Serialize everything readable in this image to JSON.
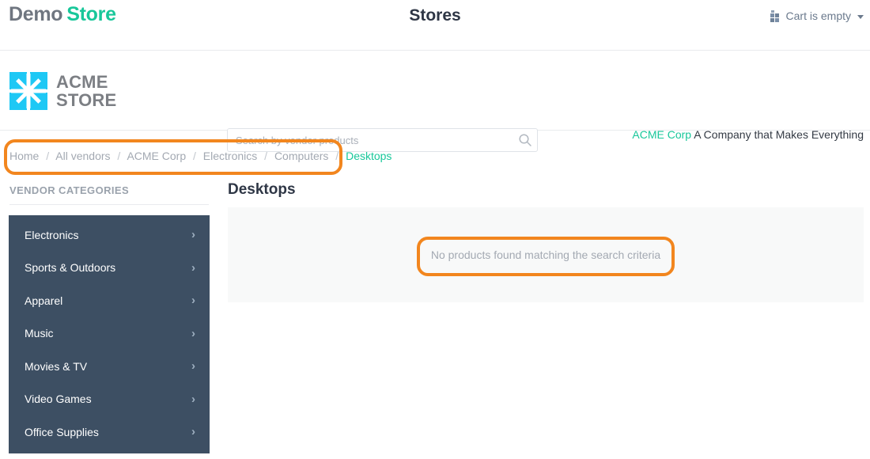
{
  "topbar": {
    "brand_primary": "Demo",
    "brand_secondary": "Store",
    "page_heading": "Stores",
    "cart_label": "Cart is empty",
    "cart_icon": "cart-grid-icon",
    "caret_icon": "chevron-down-icon"
  },
  "vendor_header": {
    "logo_line1": "ACME",
    "logo_line2": "STORE",
    "logo_icon": "acme-star-square-icon",
    "search_placeholder": "Search by vendor products",
    "search_value": "",
    "search_icon": "search-icon",
    "vendor_link": "ACME Corp",
    "vendor_tagline": "A Company that Makes Everything"
  },
  "breadcrumb": {
    "separator": "/",
    "items": [
      {
        "label": "Home",
        "current": false
      },
      {
        "label": "All vendors",
        "current": false
      },
      {
        "label": "ACME Corp",
        "current": false
      },
      {
        "label": "Electronics",
        "current": false
      },
      {
        "label": "Computers",
        "current": false
      },
      {
        "label": "Desktops",
        "current": true
      }
    ]
  },
  "sidebar": {
    "title": "VENDOR CATEGORIES",
    "chevron_icon": "chevron-right-icon",
    "items": [
      {
        "label": "Electronics"
      },
      {
        "label": "Sports & Outdoors"
      },
      {
        "label": "Apparel"
      },
      {
        "label": "Music"
      },
      {
        "label": "Movies & TV"
      },
      {
        "label": "Video Games"
      },
      {
        "label": "Office Supplies"
      }
    ]
  },
  "main": {
    "title": "Desktops",
    "empty_message": "No products found matching the search criteria"
  },
  "colors": {
    "brand_teal": "#18c79a",
    "acme_cyan": "#1ec8f5",
    "sidebar_navy": "#3d4f63",
    "highlight_orange": "#f2861e",
    "panel_gray": "#f8f9f9",
    "muted_text": "#a3a9b2"
  }
}
